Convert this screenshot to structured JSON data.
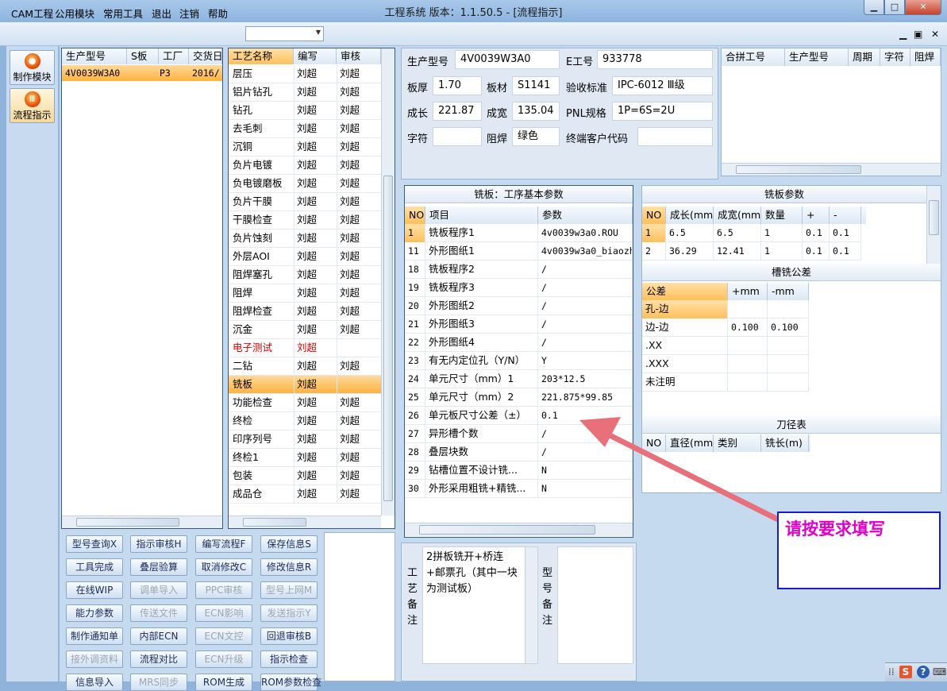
{
  "window": {
    "title": "工程系统   版本：1.1.50.5 - [流程指示]",
    "min": "▁",
    "max": "□",
    "close": "✕"
  },
  "menu": {
    "items": [
      "CAM工程",
      "公用模块",
      "常用工具",
      "退出",
      "注销",
      "帮助"
    ],
    "combo_value": "",
    "mdi": [
      "▁",
      "▣",
      "✕"
    ]
  },
  "nav": [
    {
      "label": "制作模块"
    },
    {
      "label": "流程指示"
    }
  ],
  "order_list": {
    "headers": [
      "生产型号",
      "S板",
      "工厂",
      "交货日"
    ],
    "rows": [
      [
        "4V0039W3A0",
        "",
        "P3",
        "2016/"
      ]
    ]
  },
  "process_list": {
    "headers": [
      "工艺名称",
      "编写",
      "审核"
    ],
    "rows": [
      {
        "name": "层压",
        "w": "刘超",
        "r": "刘超"
      },
      {
        "name": "铝片钻孔",
        "w": "刘超",
        "r": "刘超"
      },
      {
        "name": "钻孔",
        "w": "刘超",
        "r": "刘超"
      },
      {
        "name": "去毛刺",
        "w": "刘超",
        "r": "刘超"
      },
      {
        "name": "沉铜",
        "w": "刘超",
        "r": "刘超"
      },
      {
        "name": "负片电镀",
        "w": "刘超",
        "r": "刘超"
      },
      {
        "name": "负电镀磨板",
        "w": "刘超",
        "r": "刘超"
      },
      {
        "name": "负片干膜",
        "w": "刘超",
        "r": "刘超"
      },
      {
        "name": "干膜检查",
        "w": "刘超",
        "r": "刘超"
      },
      {
        "name": "负片蚀刻",
        "w": "刘超",
        "r": "刘超"
      },
      {
        "name": "外层AOI",
        "w": "刘超",
        "r": "刘超"
      },
      {
        "name": "阻焊塞孔",
        "w": "刘超",
        "r": "刘超"
      },
      {
        "name": "阻焊",
        "w": "刘超",
        "r": "刘超"
      },
      {
        "name": "阻焊检查",
        "w": "刘超",
        "r": "刘超"
      },
      {
        "name": "沉金",
        "w": "刘超",
        "r": "刘超"
      },
      {
        "name": "电子测试",
        "w": "刘超",
        "r": ""
      },
      {
        "name": "二钻",
        "w": "刘超",
        "r": "刘超"
      },
      {
        "name": "铣板",
        "w": "刘超",
        "r": ""
      },
      {
        "name": "功能检查",
        "w": "刘超",
        "r": "刘超"
      },
      {
        "name": "终检",
        "w": "刘超",
        "r": "刘超"
      },
      {
        "name": "印序列号",
        "w": "刘超",
        "r": "刘超"
      },
      {
        "name": "终检1",
        "w": "刘超",
        "r": "刘超"
      },
      {
        "name": "包装",
        "w": "刘超",
        "r": "刘超"
      },
      {
        "name": "成品仓",
        "w": "刘超",
        "r": "刘超"
      }
    ]
  },
  "buttons": [
    {
      "label": "型号查询X",
      "enabled": true
    },
    {
      "label": "指示审核H",
      "enabled": true
    },
    {
      "label": "编写流程F",
      "enabled": true
    },
    {
      "label": "保存信息S",
      "enabled": true
    },
    {
      "label": "工具完成",
      "enabled": true
    },
    {
      "label": "叠层验算",
      "enabled": true
    },
    {
      "label": "取消修改C",
      "enabled": true
    },
    {
      "label": "修改信息R",
      "enabled": true
    },
    {
      "label": "在线WIP",
      "enabled": true
    },
    {
      "label": "调单导入",
      "enabled": false
    },
    {
      "label": "PPC审核",
      "enabled": false
    },
    {
      "label": "型号上网M",
      "enabled": false
    },
    {
      "label": "能力参数",
      "enabled": true
    },
    {
      "label": "传送文件",
      "enabled": false
    },
    {
      "label": "ECN影响",
      "enabled": false
    },
    {
      "label": "发送指示Y",
      "enabled": false
    },
    {
      "label": "制作通知单",
      "enabled": true
    },
    {
      "label": "内部ECN",
      "enabled": true
    },
    {
      "label": "ECN文控",
      "enabled": false
    },
    {
      "label": "回退审核B",
      "enabled": true
    },
    {
      "label": "接外调资料",
      "enabled": false
    },
    {
      "label": "流程对比",
      "enabled": true
    },
    {
      "label": "ECN升级",
      "enabled": false
    },
    {
      "label": "指示检查",
      "enabled": true
    },
    {
      "label": "信息导入",
      "enabled": true
    },
    {
      "label": "MRS同步",
      "enabled": false
    },
    {
      "label": "ROM生成",
      "enabled": true
    },
    {
      "label": "ROM参数检查",
      "enabled": true
    }
  ],
  "info": {
    "prod_label": "生产型号",
    "prod": "4V0039W3A0",
    "e_label": "E工号",
    "e": "933778",
    "thick_label": "板厚",
    "thick": "1.70",
    "mat_label": "板材",
    "mat": "S1141",
    "std_label": "验收标准",
    "std": "IPC-6012 Ⅲ级",
    "len_label": "成长",
    "len": "221.87",
    "wid_label": "成宽",
    "wid": "135.04",
    "pnl_label": "PNL规格",
    "pnl": "1P=6S=2U",
    "char_label": "字符",
    "char": "",
    "mask_label": "阻焊",
    "mask": "绿色",
    "cust_label": "终端客户代码",
    "cust": ""
  },
  "merge_table": {
    "headers": [
      "合拼工号",
      "生产型号",
      "周期",
      "字符",
      "阻焊"
    ]
  },
  "routing": {
    "title": "铣板：工序基本参数",
    "headers": [
      "NO",
      "项目",
      "参数"
    ],
    "rows": [
      [
        "1",
        "铣板程序1",
        "4v0039w3a0.ROU"
      ],
      [
        "11",
        "外形图纸1",
        "4v0039w3a0_biaozh"
      ],
      [
        "18",
        "铣板程序2",
        "/"
      ],
      [
        "19",
        "铣板程序3",
        "/"
      ],
      [
        "20",
        "外形图纸2",
        "/"
      ],
      [
        "21",
        "外形图纸3",
        "/"
      ],
      [
        "22",
        "外形图纸4",
        "/"
      ],
      [
        "23",
        "有无内定位孔（Y/N）",
        "Y"
      ],
      [
        "24",
        "单元尺寸（mm）1",
        "203*12.5"
      ],
      [
        "25",
        "单元尺寸（mm）2",
        "221.875*99.85"
      ],
      [
        "26",
        "单元板尺寸公差（±）",
        "0.1"
      ],
      [
        "27",
        "异形槽个数",
        "/"
      ],
      [
        "28",
        "叠层块数",
        "/"
      ],
      [
        "29",
        "钻槽位置不设计铣...",
        "N"
      ],
      [
        "30",
        "外形采用粗铣+精铣...",
        "N"
      ]
    ]
  },
  "mill_params": {
    "title": "铣板参数",
    "headers": [
      "NO",
      "成长(mm)",
      "成宽(mm)",
      "数量",
      "+",
      "-"
    ],
    "rows": [
      [
        "1",
        "6.5",
        "6.5",
        "1",
        "0.1",
        "0.1"
      ],
      [
        "2",
        "36.29",
        "12.41",
        "1",
        "0.1",
        "0.1"
      ]
    ]
  },
  "slot_tol": {
    "title": "槽铣公差",
    "headers": [
      "公差",
      "+mm",
      "-mm"
    ],
    "rows": [
      [
        "孔-边",
        "",
        ""
      ],
      [
        "边-边",
        "0.100",
        "0.100"
      ],
      [
        ".XX",
        "",
        ""
      ],
      [
        ".XXX",
        "",
        ""
      ],
      [
        "未注明",
        "",
        ""
      ]
    ]
  },
  "tool_table": {
    "title": "刀径表",
    "headers": [
      "NO",
      "直径(mm)",
      "类别",
      "铣长(m)"
    ]
  },
  "remarks": {
    "process_label": "工艺备注",
    "process": "2拼板铣开+桥连+邮票孔（其中一块为测试板）",
    "model_label": "型号备注",
    "model": ""
  },
  "annotation": {
    "text": "请按要求填写",
    "arrow_color": "#e8707a",
    "text_color": "#e000c8"
  },
  "tray": {
    "ime": "S",
    "help": "?"
  }
}
